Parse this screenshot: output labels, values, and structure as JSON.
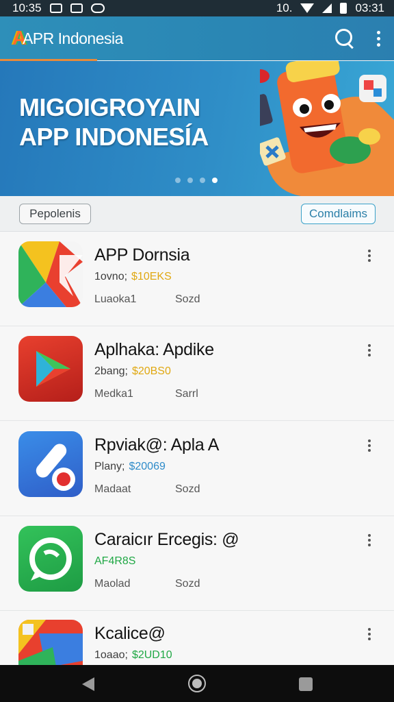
{
  "status_bar": {
    "time_left": "10:35",
    "time_right": "03:31",
    "network": "10."
  },
  "app_bar": {
    "logo_letter": "A",
    "title": "APR Indonesia"
  },
  "banner": {
    "line1": "MIGOIGROYAIN",
    "line2": "APP INDONESÍA",
    "slide_count": 4,
    "active_slide": 4
  },
  "filters": {
    "left_chip": "Pepolenis",
    "right_chip": "Comdlaims"
  },
  "apps": [
    {
      "name": "APP Dornsia",
      "meta": "1ovno;",
      "price": "$10EKS",
      "price_color": "#e0a812",
      "sub_left": "Luaoka1",
      "sub_right": "Sozd",
      "icon": "kite-icon"
    },
    {
      "name": "Aplhaka: Apdike",
      "meta": "2bang;",
      "price": "$20BS0",
      "price_color": "#e0a812",
      "sub_left": "Medka1",
      "sub_right": "Sarrl",
      "icon": "play-icon"
    },
    {
      "name": "Rpviak@: Apla A",
      "meta": "Plany;",
      "price": "$20069",
      "price_color": "#2e8bc9",
      "sub_left": "Madaat",
      "sub_right": "Sozd",
      "icon": "tool-icon"
    },
    {
      "name": "Caraicır Ercegis: @",
      "meta": "",
      "price": "AF4R8S",
      "price_color": "#20a845",
      "sub_left": "Maolad",
      "sub_right": "Sozd",
      "icon": "chat-icon"
    },
    {
      "name": "Kcalice@",
      "meta": "1oaao;",
      "price": "$2UD10",
      "price_color": "#20a845",
      "sub_left": "",
      "sub_right": "",
      "icon": "colorful-icon"
    }
  ]
}
